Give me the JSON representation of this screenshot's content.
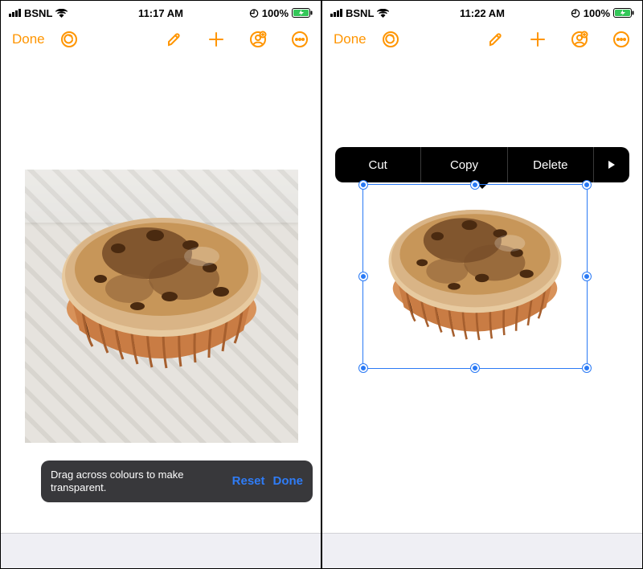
{
  "left": {
    "statusbar": {
      "carrier": "BSNL",
      "time": "11:17 AM",
      "battery": "100%"
    },
    "toolbar": {
      "done": "Done"
    },
    "overlay": {
      "message": "Drag across colours to make transparent.",
      "reset": "Reset",
      "done": "Done"
    }
  },
  "right": {
    "statusbar": {
      "carrier": "BSNL",
      "time": "11:22 AM",
      "battery": "100%"
    },
    "toolbar": {
      "done": "Done"
    },
    "context_menu": {
      "cut": "Cut",
      "copy": "Copy",
      "delete": "Delete"
    }
  },
  "icons": {
    "undo": "undo-icon",
    "brush": "brush-icon",
    "plus": "plus-icon",
    "addperson": "add-person-icon",
    "more": "more-icon"
  }
}
